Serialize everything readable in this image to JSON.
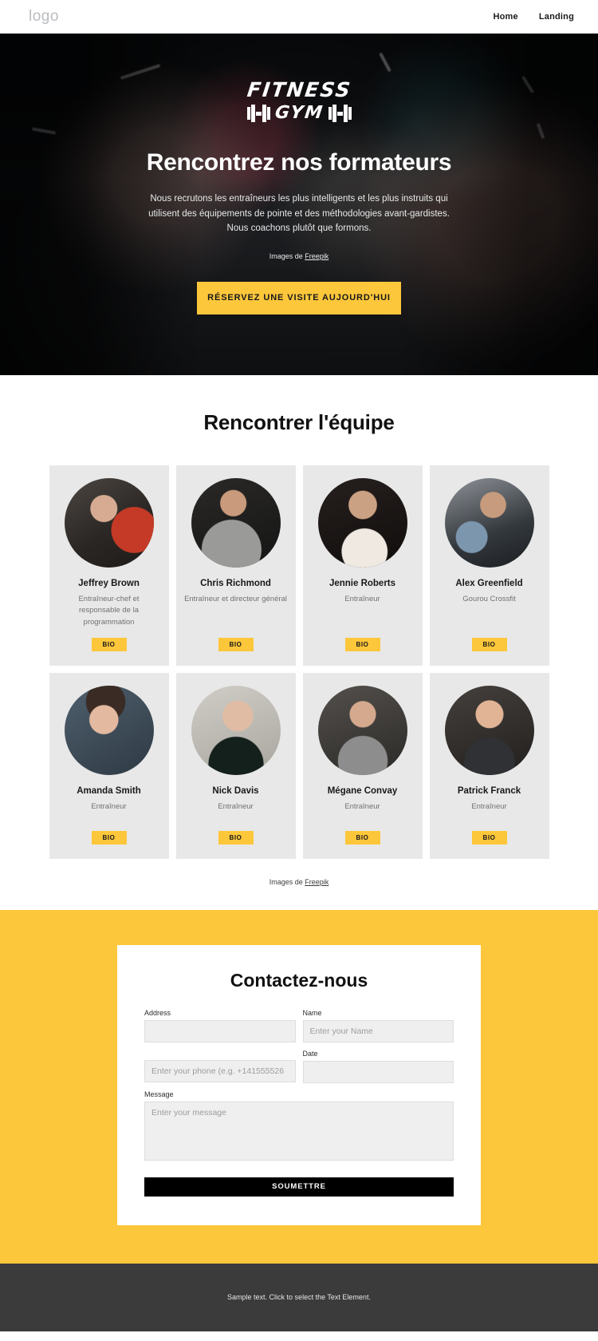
{
  "header": {
    "logo": "logo",
    "nav": [
      {
        "label": "Home"
      },
      {
        "label": "Landing"
      }
    ]
  },
  "hero": {
    "brand_line1": "FITNESS",
    "brand_line2": "GYM",
    "title": "Rencontrez nos formateurs",
    "subtitle": "Nous recrutons les entraîneurs les plus intelligents et les plus instruits qui utilisent des équipements de pointe et des méthodologies avant-gardistes. Nous coachons plutôt que formons.",
    "credit_prefix": "Images de ",
    "credit_link": "Freepik",
    "cta_label": "RÉSERVEZ UNE VISITE AUJOURD'HUI",
    "accent_color": "#fdc73b"
  },
  "team": {
    "title": "Rencontrer l'équipe",
    "bio_label": "BIO",
    "credit_prefix": "Images de ",
    "credit_link": "Freepik",
    "members": [
      {
        "name": "Jeffrey Brown",
        "role": "Entraîneur-chef et responsable de la programmation",
        "bio": "BIO"
      },
      {
        "name": "Chris Richmond",
        "role": "Entraîneur et directeur général",
        "bio": "BIO"
      },
      {
        "name": "Jennie Roberts",
        "role": "Entraîneur",
        "bio": "BIO"
      },
      {
        "name": "Alex Greenfield",
        "role": "Gourou Crossfit",
        "bio": "BIO"
      },
      {
        "name": "Amanda Smith",
        "role": "Entraîneur",
        "bio": "BIO"
      },
      {
        "name": "Nick Davis",
        "role": "Entraîneur",
        "bio": "BIO"
      },
      {
        "name": "Mégane Convay",
        "role": "Entraîneur",
        "bio": "BIO"
      },
      {
        "name": "Patrick Franck",
        "role": "Entraîneur",
        "bio": "BIO"
      }
    ]
  },
  "contact": {
    "title": "Contactez-nous",
    "fields": {
      "address_label": "Address",
      "address_placeholder": "",
      "name_label": "Name",
      "name_placeholder": "Enter your Name",
      "phone_placeholder": "Enter your phone (e.g. +141555526",
      "date_label": "Date",
      "date_placeholder": "",
      "message_label": "Message",
      "message_placeholder": "Enter your message"
    },
    "submit_label": "SOUMETTRE",
    "background_color": "#fdc73b"
  },
  "footer": {
    "text": "Sample text. Click to select the Text Element."
  }
}
